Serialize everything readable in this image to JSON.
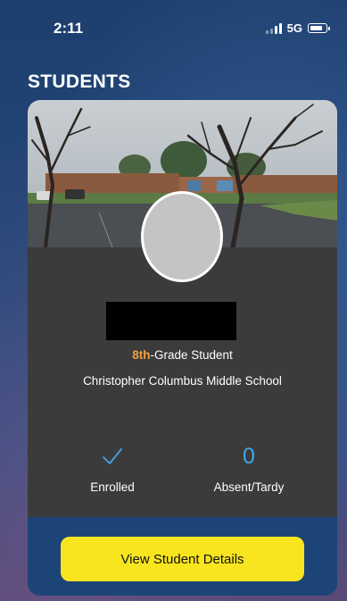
{
  "status_bar": {
    "time": "2:11",
    "network": "5G",
    "icons": [
      "signal-icon",
      "battery-icon"
    ]
  },
  "page": {
    "title": "STUDENTS"
  },
  "student_card": {
    "grade_number": "8th",
    "grade_suffix": "-Grade Student",
    "school": "Christopher Columbus Middle School",
    "stats": {
      "enrolled": {
        "icon": "checkmark-icon",
        "label": "Enrolled"
      },
      "absent_tardy": {
        "value": "0",
        "label": "Absent/Tardy"
      }
    },
    "action_button": "View Student Details"
  },
  "colors": {
    "accent_blue": "#3fa6e8",
    "grade_orange": "#f0a040",
    "button_yellow": "#f9e51f",
    "card_bg": "#3b3b3b",
    "footer_bg": "#1d4477"
  }
}
